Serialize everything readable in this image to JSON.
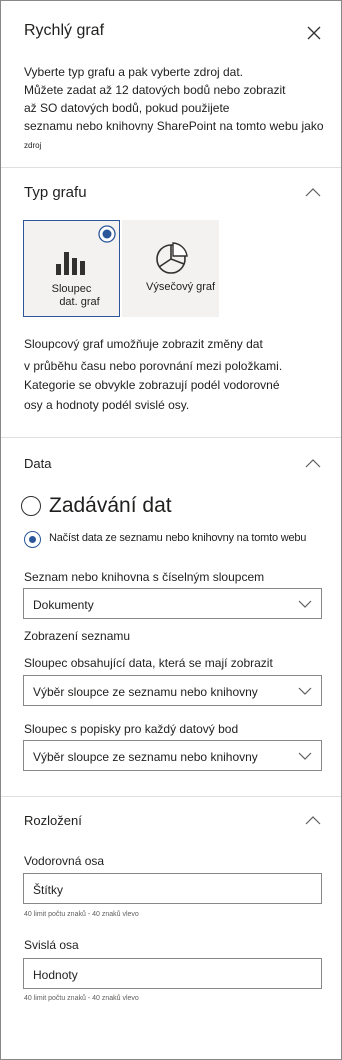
{
  "panel": {
    "title": "Rychlý graf",
    "intro_lines": [
      "Vyberte typ grafu a pak vyberte zdroj dat.",
      "Můžete zadat až 12 datových bodů nebo zobrazit",
      "až SO datových bodů, pokud použijete",
      "seznamu nebo knihovny SharePoint na tomto webu jako"
    ],
    "intro_small": "zdroj"
  },
  "chart_type": {
    "heading": "Typ grafu",
    "options": [
      {
        "label_line1": "Sloupec",
        "label_line2": "dat. graf",
        "selected": true
      },
      {
        "label": "Výsečový graf",
        "selected": false
      }
    ],
    "description_lines": [
      "Sloupcový graf umožňuje zobrazit změny dat",
      "v průběhu času nebo porovnání mezi položkami.",
      "Kategorie se obvykle zobrazují podél vodorovné",
      "osy a hodnoty podél svislé osy."
    ]
  },
  "data_section": {
    "heading": "Data",
    "option_manual": "Zadávání dat",
    "option_list": "Načíst data ze seznamu nebo knihovny na tomto webu",
    "list_label": "Seznam nebo knihovna s číselným sloupcem",
    "list_value": "Dokumenty",
    "view_label": "Zobrazení seznamu",
    "data_column_label": "Sloupec obsahující data, která se mají zobrazit",
    "data_column_value": "Výběr sloupce ze seznamu nebo knihovny",
    "labels_column_label": "Sloupec s popisky pro každý datový bod",
    "labels_column_value": "Výběr sloupce ze seznamu nebo knihovny"
  },
  "layout_section": {
    "heading": "Rozložení",
    "horizontal_label": "Vodorovná osa",
    "horizontal_value": "Štítky",
    "horizontal_hint": "40 limit  počtu  znaků - 40 znaků vlevo",
    "vertical_label": "Svislá osa",
    "vertical_value": "Hodnoty",
    "vertical_hint": "40 limit  počtu  znaků - 40 znaků vlevo"
  },
  "colors": {
    "accent": "#2b579a",
    "border": "#8a8886",
    "divider": "#e1dfdd",
    "tile_bg": "#f3f2f1"
  }
}
